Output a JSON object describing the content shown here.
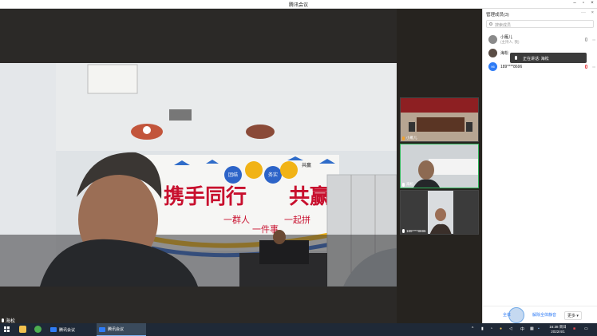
{
  "window": {
    "title": "腾讯会议"
  },
  "main_video": {
    "banner_main": "携手同行",
    "banner_right": "共赢",
    "banner_sub": [
      "一群人",
      "一件事",
      "一起拼"
    ],
    "circles": [
      "团结",
      "务实",
      "共赢"
    ]
  },
  "active_speaker": "海松",
  "thumbnails": [
    {
      "label": "小雁儿"
    },
    {
      "label": "海松"
    },
    {
      "label": "189****8696"
    }
  ],
  "panel": {
    "title": "管理成员(3)",
    "search_placeholder": "搜索成员",
    "members": [
      {
        "name": "小雁儿",
        "role": "(主持人, 我)",
        "avatar": ""
      },
      {
        "name": "海松",
        "role": "",
        "avatar": ""
      },
      {
        "name": "189****8696",
        "role": "",
        "avatar": "96"
      }
    ],
    "speaking_tooltip": "正在讲话: 海松",
    "footer": {
      "mute_all": "全体",
      "unmute_all": "解除全体静音",
      "more": "更多"
    }
  },
  "taskbar": {
    "apps": [
      {
        "label": "腾讯会议"
      },
      {
        "label": "腾讯会议"
      }
    ],
    "tray_lang": "中",
    "time": "16:38 周日",
    "date": "2022/4/1"
  }
}
